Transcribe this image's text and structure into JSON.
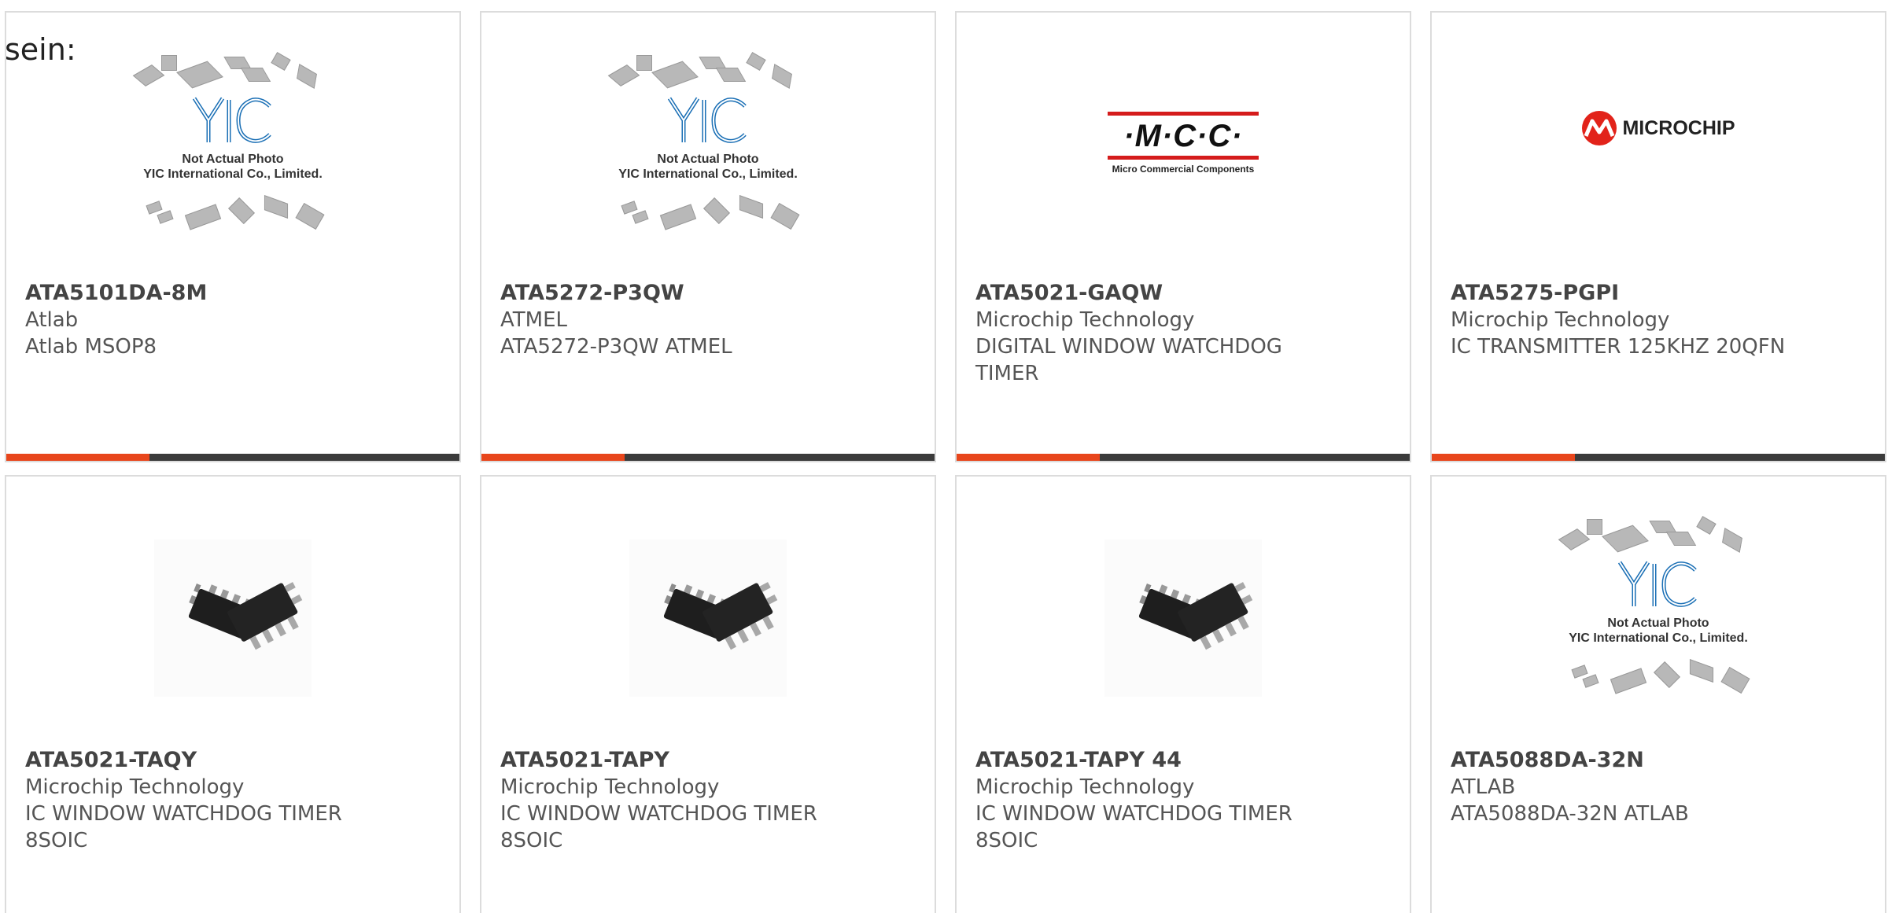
{
  "intro_text": "sein:",
  "image_labels": {
    "yic_caption_line1": "Not Actual Photo",
    "yic_caption_line2": "YIC International Co., Limited.",
    "mcc_mark": "·M·C·C·",
    "mcc_sub": "Micro Commercial Components",
    "microchip_word": "MICROCHIP"
  },
  "colors": {
    "accent": "#e8461c",
    "bar_dark": "#3b3b3b",
    "mcc_red": "#d51c1c",
    "microchip_red": "#e2231a",
    "yic_blue": "#1a6fb5"
  },
  "products": [
    {
      "part": "ATA5101DA-8M",
      "maker": "Atlab",
      "desc": "Atlab MSOP8",
      "image": "yic-placeholder"
    },
    {
      "part": "ATA5272-P3QW",
      "maker": "ATMEL",
      "desc": "ATA5272-P3QW ATMEL",
      "image": "yic-placeholder"
    },
    {
      "part": "ATA5021-GAQW",
      "maker": "Microchip Technology",
      "desc": "DIGITAL WINDOW WATCHDOG TIMER",
      "image": "mcc-logo"
    },
    {
      "part": "ATA5275-PGPI",
      "maker": "Microchip Technology",
      "desc": "IC TRANSMITTER 125KHZ 20QFN",
      "image": "microchip-logo"
    },
    {
      "part": "ATA5021-TAQY",
      "maker": "Microchip Technology",
      "desc": "IC WINDOW WATCHDOG TIMER 8SOIC",
      "image": "soic8-photo"
    },
    {
      "part": "ATA5021-TAPY",
      "maker": "Microchip Technology",
      "desc": "IC WINDOW WATCHDOG TIMER 8SOIC",
      "image": "soic8-photo"
    },
    {
      "part": "ATA5021-TAPY 44",
      "maker": "Microchip Technology",
      "desc": "IC WINDOW WATCHDOG TIMER 8SOIC",
      "image": "soic8-photo"
    },
    {
      "part": "ATA5088DA-32N",
      "maker": "ATLAB",
      "desc": "ATA5088DA-32N ATLAB",
      "image": "yic-placeholder"
    }
  ]
}
